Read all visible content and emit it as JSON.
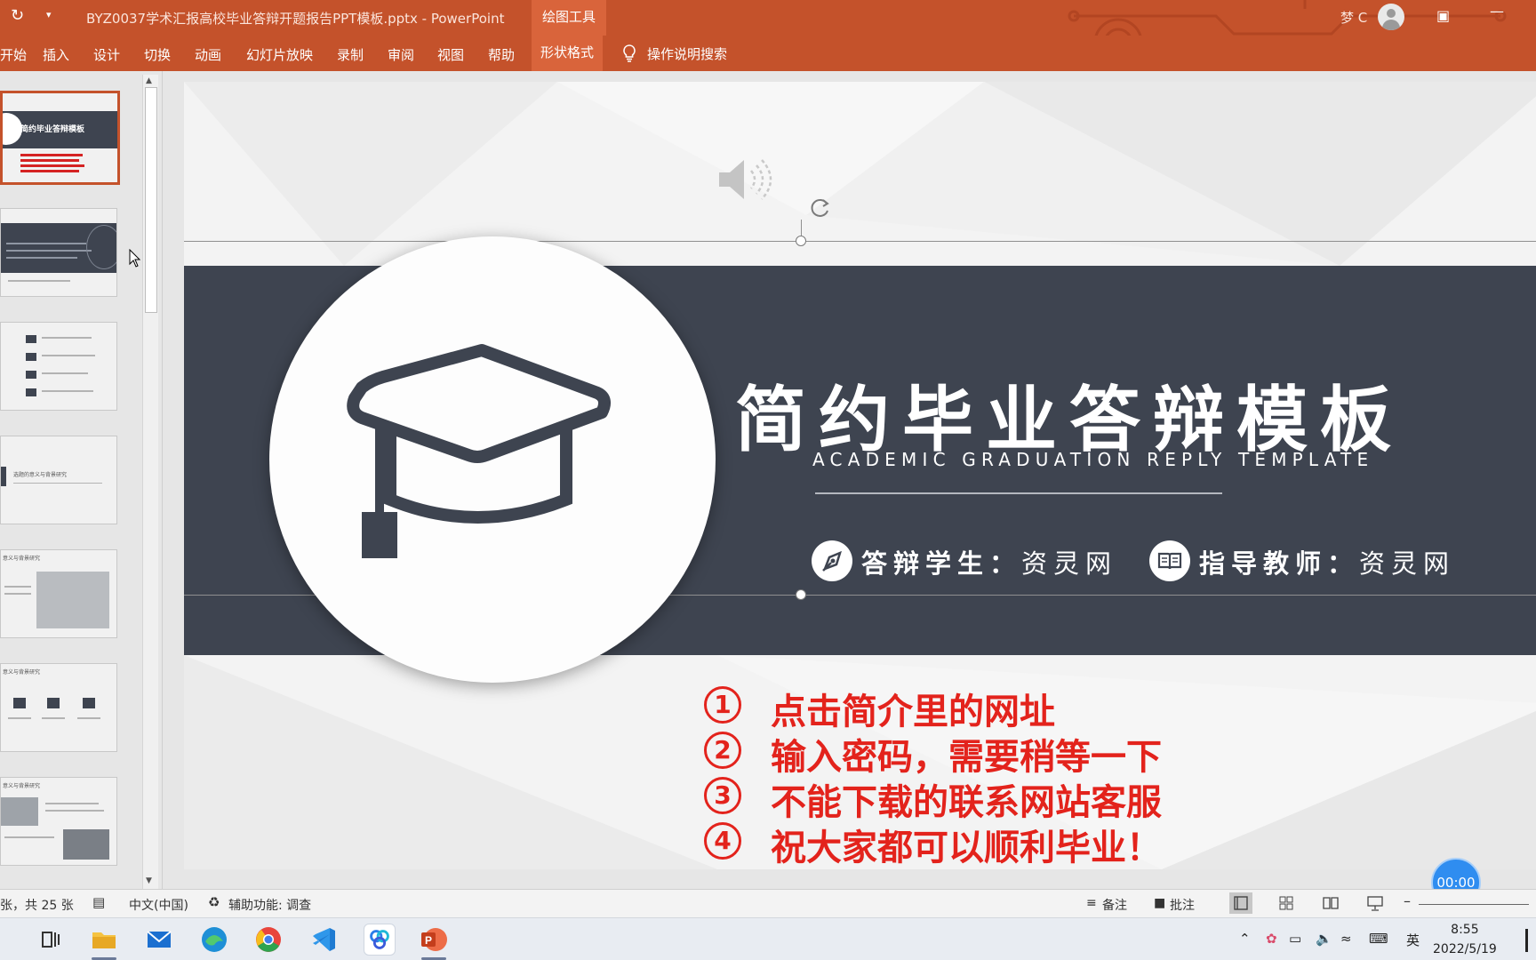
{
  "window": {
    "title": "BYZ0037学术汇报高校毕业答辩开题报告PPT模板.pptx  -  PowerPoint",
    "context_tab": "绘图工具",
    "user": "梦 C",
    "accent_color": "#c4522b"
  },
  "ribbon": {
    "tabs": [
      "开始",
      "插入",
      "设计",
      "切换",
      "动画",
      "幻灯片放映",
      "录制",
      "审阅",
      "视图",
      "帮助",
      "形状格式"
    ],
    "active_tab": "形状格式",
    "tell_me": "操作说明搜索"
  },
  "slide": {
    "title": "简约毕业答辩模板",
    "subtitle": "ACADEMIC GRADUATION REPLY TEMPLATE",
    "student_label": "答辩学生：",
    "student_name": "资灵网",
    "teacher_label": "指导教师：",
    "teacher_name": "资灵网",
    "steps": [
      {
        "num": "1",
        "text": "点击简介里的网址"
      },
      {
        "num": "2",
        "text": "输入密码，需要稍等一下"
      },
      {
        "num": "3",
        "text": "不能下载的联系网站客服"
      },
      {
        "num": "4",
        "text": "祝大家都可以顺利毕业！"
      }
    ],
    "band_color": "#3e4450",
    "step_color": "#e3231c"
  },
  "thumbnails": {
    "thumb1_title": "简约毕业答辩模板",
    "thumb4_title": "选题的意义与背景研究",
    "thumb5_title": "意义与背景研究",
    "thumb6_title": "意义与背景研究",
    "thumb7_title": "意义与背景研究"
  },
  "timer": "00:00",
  "status": {
    "slide_count": "张，共 25 张",
    "language": "中文(中国)",
    "accessibility": "辅助功能: 调查",
    "notes": "备注",
    "comments": "批注"
  },
  "taskbar": {
    "apps": [
      "task-view",
      "file-explorer",
      "mail",
      "edge",
      "chrome",
      "vscode",
      "app",
      "powerpoint"
    ],
    "ime": "英",
    "time": "8:55",
    "date": "2022/5/19"
  }
}
